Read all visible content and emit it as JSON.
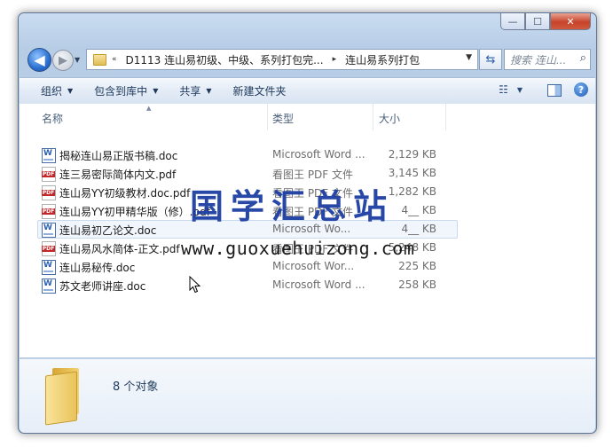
{
  "window": {
    "caption_buttons": [
      {
        "name": "minimize-button",
        "glyph": "—"
      },
      {
        "name": "maximize-button",
        "glyph": "☐"
      },
      {
        "name": "close-button",
        "glyph": "✕"
      }
    ]
  },
  "nav": {
    "back_glyph": "◀",
    "forward_glyph": "▶",
    "breadcrumb": [
      "«",
      "D1113 连山易初级、中级、系列打包完...",
      "▸",
      "连山易系列打包"
    ],
    "refresh_glyph": "⇆",
    "search_placeholder": "搜索 连山...",
    "search_glyph": "🔍"
  },
  "toolbar": {
    "organize": "组织",
    "include_in_library": "包含到库中",
    "share": "共享",
    "new_folder": "新建文件夹",
    "help_glyph": "?"
  },
  "columns": {
    "name": "名称",
    "type": "类型",
    "size": "大小"
  },
  "files": [
    {
      "name": "揭秘连山易正版书稿.doc",
      "type": "Microsoft Word ...",
      "size": "2,129 KB",
      "icon": "word-doc-icon"
    },
    {
      "name": "连三易密际简体内文.pdf",
      "type": "看图王 PDF 文件",
      "size": "3,145 KB",
      "icon": "pdf-icon"
    },
    {
      "name": "连山易YY初级教材.doc.pdf",
      "type": "看图王 PDF 文件",
      "size": "1,282 KB",
      "icon": "pdf-icon"
    },
    {
      "name": "连山易YY初甲精华版（修）.pdf",
      "type": "看图王 PDF 文件",
      "size": "4__ KB",
      "icon": "pdf-icon"
    },
    {
      "name": "连山易初乙论文.doc",
      "type": "Microsoft Wo...",
      "size": "4__ KB",
      "icon": "word-doc-icon"
    },
    {
      "name": "连山易风水简体-正文.pdf",
      "type": "看图王 PDF 文件",
      "size": "5,248 KB",
      "icon": "pdf-icon"
    },
    {
      "name": "连山易秘传.doc",
      "type": "Microsoft Wor...",
      "size": "225 KB",
      "icon": "word-doc-icon"
    },
    {
      "name": "苏文老师讲座.doc",
      "type": "Microsoft Word ...",
      "size": "258 KB",
      "icon": "word-doc-icon"
    }
  ],
  "details": {
    "count": "8 个对象"
  },
  "watermark": {
    "title": "国学汇总站",
    "url": "www.guoxuehuizong.com"
  },
  "pdf_badge": "PDF"
}
